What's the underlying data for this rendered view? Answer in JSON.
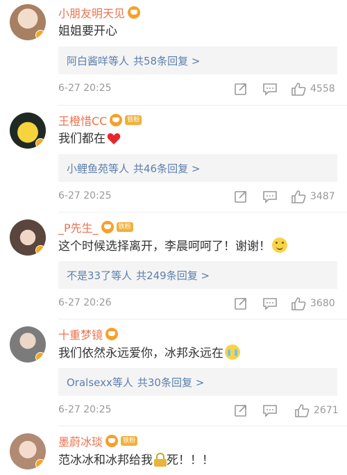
{
  "comments": [
    {
      "username": "小朋友明天见",
      "text": "姐姐要开心",
      "emoji": "",
      "has_fan_badge": false,
      "reply_names": "阿白酱咩等人",
      "reply_count": "共58条回复 >",
      "time": "6-27 20:25",
      "likes": "4558",
      "avatar_color": "#c9a88c"
    },
    {
      "username": "王橙惜CC",
      "text": "我们都在",
      "emoji": "heart-emoji",
      "has_fan_badge": true,
      "fan_badge": "铁粉",
      "reply_names": "小鲤鱼苑等人",
      "reply_count": "共46条回复 >",
      "time": "6-27 20:25",
      "likes": "3487",
      "avatar_color": "#2d3a2f"
    },
    {
      "username": "_P先生_",
      "text": "这个时候选择离开，李晨呵呵了！谢谢！",
      "emoji": "smile-emoji",
      "has_fan_badge": true,
      "fan_badge": "铁粉",
      "reply_names": "不是33了等人",
      "reply_count": "共249条回复 >",
      "time": "6-27 20:26",
      "likes": "3680",
      "avatar_color": "#b89a86"
    },
    {
      "username": "十重梦镜",
      "text": "我们依然永远爱你，冰邦永远在",
      "emoji": "crying-emoji",
      "has_fan_badge": false,
      "reply_names": "Oralsexx等人",
      "reply_count": "共30条回复 >",
      "time": "6-27 20:25",
      "likes": "2671",
      "avatar_color": "#8a8a8a"
    },
    {
      "username": "墨蔚冰琰",
      "text_before": "范冰冰和冰邦给我",
      "text_after": "死！！！",
      "emoji": "lock-emoji",
      "has_fan_badge": true,
      "fan_badge": "铁粉",
      "avatar_color": "#d8b8a4"
    }
  ],
  "colors": {
    "username": "#eb7350",
    "reply_link": "#5b7fac",
    "meta": "#999999",
    "reply_bg": "#f4f4f4"
  },
  "icons": [
    "share-icon",
    "comment-icon",
    "like-icon",
    "crown-badge-icon",
    "verified-badge-icon"
  ]
}
